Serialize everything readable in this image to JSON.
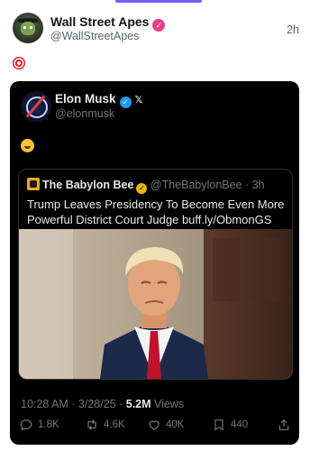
{
  "post": {
    "author_name": "Wall Street Apes",
    "author_handle": "@WallStreetApes",
    "time": "2h"
  },
  "embedded": {
    "author_name": "Elon Musk",
    "author_handle": "@elonmusk",
    "quote": {
      "author_name": "The Babylon Bee",
      "author_handle": "@TheBabylonBee",
      "time": "· 3h",
      "text": "Trump Leaves Presidency To Become Even More Powerful District Court Judge buff.ly/ObmonGS"
    },
    "timestamp": "10:28 AM · 3/28/25 · ",
    "views_count": "5.2M",
    "views_label": " Views",
    "actions": {
      "replies": "1.8K",
      "reposts": "4.6K",
      "likes": "40K",
      "bookmarks": "440"
    }
  },
  "colors": {
    "accent": "#7a5af8",
    "verified_blue": "#1d9bf0",
    "verified_gold": "#e6b800",
    "dark_bg": "#000000"
  },
  "icons": [
    "verified-badge-icon",
    "x-logo-icon",
    "target-emoji-icon",
    "laughing-emoji-icon",
    "reply-icon",
    "repost-icon",
    "like-icon",
    "bookmark-icon",
    "share-icon"
  ]
}
